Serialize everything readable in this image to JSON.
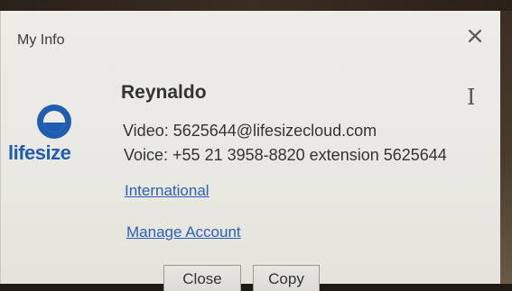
{
  "dialog": {
    "title": "My Info",
    "close_glyph": "×",
    "cursor_glyph": "I",
    "icons": [
      "close-icon",
      "text-cursor-icon",
      "lifesize-logo-icon"
    ]
  },
  "brand": {
    "name": "lifesize",
    "color": "#1f5db3"
  },
  "user": {
    "name": "Reynaldo",
    "video": "Video: 5625644@lifesizecloud.com",
    "voice": "Voice: +55 21 3958-8820 extension 5625644"
  },
  "links": {
    "international": "International",
    "manage_account": "Manage Account",
    "color": "#2a61b8"
  },
  "buttons": {
    "close": "Close",
    "copy": "Copy"
  }
}
